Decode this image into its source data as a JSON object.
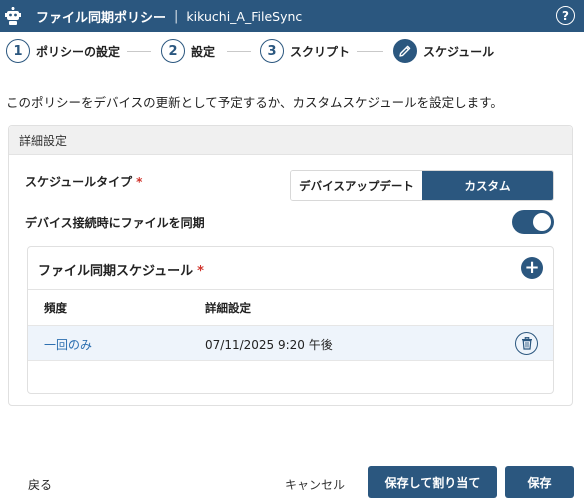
{
  "header": {
    "title": "ファイル同期ポリシー",
    "separator": "|",
    "policy_name": "kikuchi_A_FileSync",
    "app_icon": "robot-icon",
    "help_icon": "help-circle-icon",
    "help_glyph": "?"
  },
  "stepper": {
    "steps": [
      {
        "number": "1",
        "label": "ポリシーの設定"
      },
      {
        "number": "2",
        "label": "設定"
      },
      {
        "number": "3",
        "label": "スクリプト"
      },
      {
        "number": "",
        "label": "スケジュール",
        "icon": "pencil-icon"
      }
    ],
    "active_index": 3
  },
  "intro_text": "このポリシーをデバイスの更新として予定するか、カスタムスケジュールを設定します。",
  "advanced": {
    "header": "詳細設定",
    "schedule_type_label": "スケジュールタイプ",
    "required_mark": "*",
    "schedule_options": [
      "デバイスアップデート",
      "カスタム"
    ],
    "schedule_selected": "カスタム",
    "sync_on_connect_label": "デバイス接続時にファイルを同期",
    "sync_on_connect_enabled": true
  },
  "file_sync_schedule": {
    "title": "ファイル同期スケジュール",
    "required_mark": "*",
    "add_icon": "plus-circle-icon",
    "add_glyph": "+",
    "columns": [
      "頻度",
      "詳細設定"
    ],
    "rows": [
      {
        "frequency": "一回のみ",
        "detail": "07/11/2025 9:20 午後",
        "delete_icon": "trash-icon"
      }
    ]
  },
  "footer": {
    "back_label": "戻る",
    "cancel_label": "キャンセル",
    "save_assign_label": "保存して割り当て",
    "save_label": "保存"
  },
  "colors": {
    "primary": "#2b577f",
    "link": "#2b6fb0",
    "required": "#d0342c"
  }
}
